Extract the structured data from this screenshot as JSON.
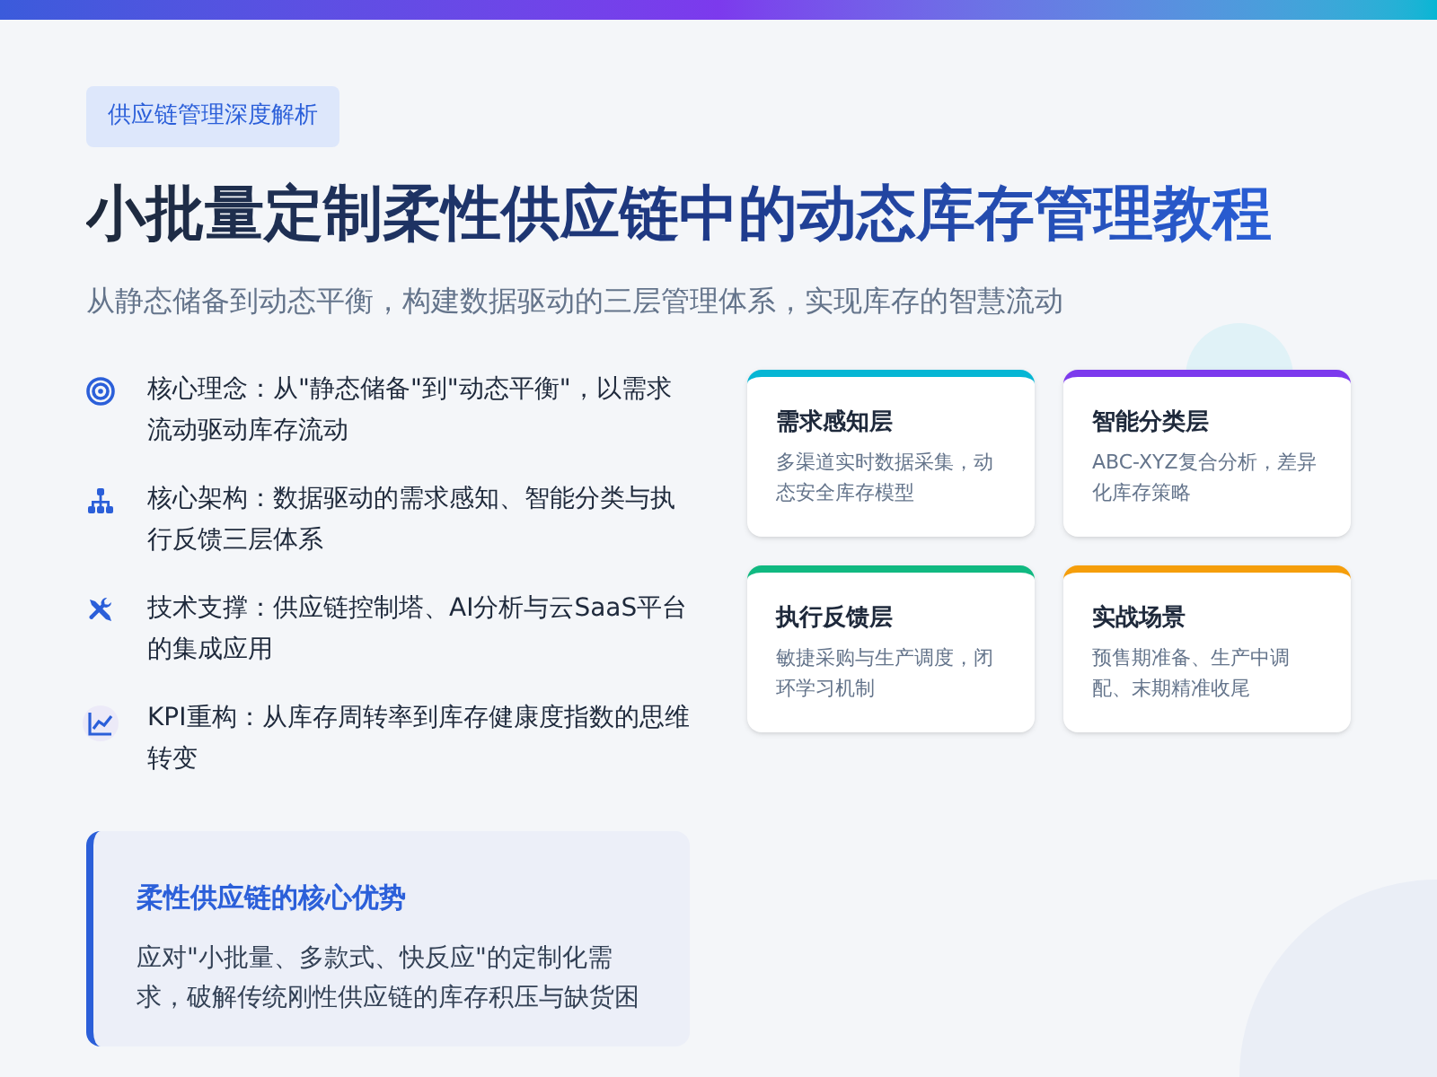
{
  "tag": "供应链管理深度解析",
  "title": "小批量定制柔性供应链中的动态库存管理教程",
  "subtitle": "从静态储备到动态平衡，构建数据驱动的三层管理体系，实现库存的智慧流动",
  "points": [
    {
      "kind": "target",
      "text": "核心理念：从\"静态储备\"到\"动态平衡\"，以需求流动驱动库存流动"
    },
    {
      "kind": "hierarchy",
      "text": "核心架构：数据驱动的需求感知、智能分类与执行反馈三层体系"
    },
    {
      "kind": "tools",
      "text": "技术支撑：供应链控制塔、AI分析与云SaaS平台的集成应用"
    },
    {
      "kind": "chart",
      "text": "KPI重构：从库存周转率到库存健康度指数的思维转变"
    }
  ],
  "cards": [
    {
      "title": "需求感知层",
      "text": "多渠道实时数据采集，动态安全库存模型",
      "color": "#06b6d4"
    },
    {
      "title": "智能分类层",
      "text": "ABC-XYZ复合分析，差异化库存策略",
      "color": "#7c3aed"
    },
    {
      "title": "执行反馈层",
      "text": "敏捷采购与生产调度，闭环学习机制",
      "color": "#10b981"
    },
    {
      "title": "实战场景",
      "text": "预售期准备、生产中调配、末期精准收尾",
      "color": "#f59e0b"
    }
  ],
  "advantage": {
    "title": "柔性供应链的核心优势",
    "text": "应对\"小批量、多款式、快反应\"的定制化需求，破解传统刚性供应链的库存积压与缺货困"
  }
}
